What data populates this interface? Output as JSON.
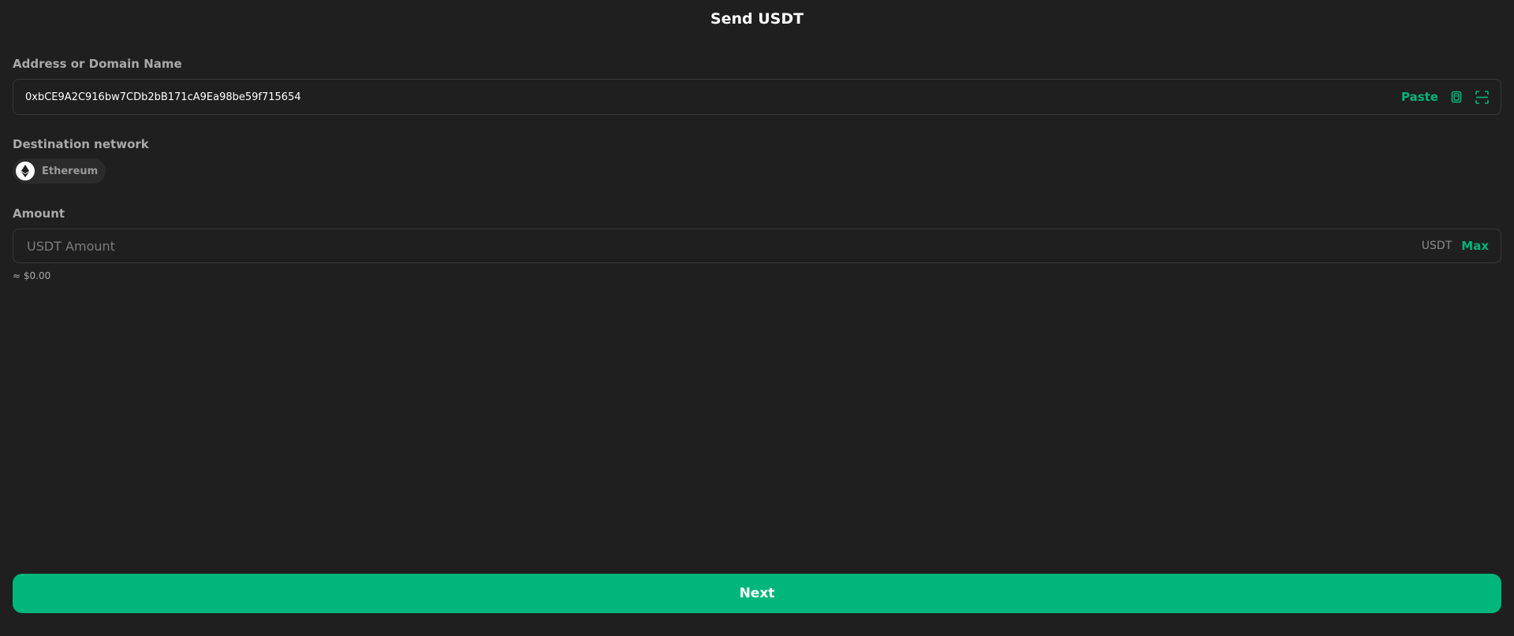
{
  "header": {
    "title": "Send USDT"
  },
  "address": {
    "label": "Address or Domain Name",
    "value": "0xbCE9A2C916bw7CDb2bB171cA9Ea98be59f715654",
    "paste_label": "Paste",
    "paste_icon": "clipboard-icon",
    "scan_icon": "qr-scan-icon"
  },
  "network": {
    "label": "Destination network",
    "name": "Ethereum",
    "icon": "ethereum-icon"
  },
  "amount": {
    "label": "Amount",
    "placeholder": "USDT Amount",
    "unit": "USDT",
    "max_label": "Max",
    "fiat_estimate": "≈ $0.00"
  },
  "footer": {
    "next_label": "Next"
  },
  "colors": {
    "background": "#1f1f1f",
    "accent": "#00b67a",
    "label": "#a9a9a9",
    "border": "#3a3a3a"
  }
}
